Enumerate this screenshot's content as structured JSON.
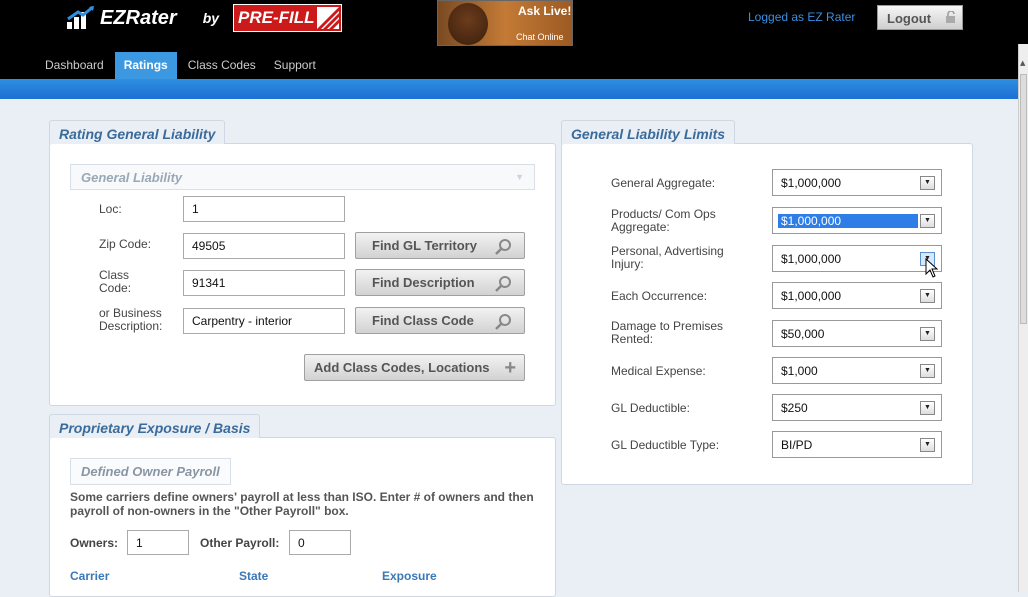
{
  "header": {
    "brand": "EZRater",
    "by": "by",
    "partner": "PRE-FILL",
    "ask_live_title": "Ask Live!",
    "ask_live_sub": "Chat Online",
    "logged_as": "Logged as EZ Rater",
    "logout_label": "Logout"
  },
  "nav": {
    "items": [
      {
        "label": "Dashboard"
      },
      {
        "label": "Ratings"
      },
      {
        "label": "Class Codes"
      },
      {
        "label": "Support"
      }
    ],
    "active": "Ratings"
  },
  "rating_panel": {
    "tab": "Rating General Liability",
    "accordion": "General Liability",
    "loc_label": "Loc:",
    "loc_value": "1",
    "zip_label": "Zip Code:",
    "zip_value": "49505",
    "class_label_1": "Class",
    "class_label_2": "Code:",
    "class_value": "91341",
    "biz_label_1": "or Business",
    "biz_label_2": "Description:",
    "biz_value": "Carpentry - interior",
    "btn_find_territory": "Find GL Territory",
    "btn_find_description": "Find Description",
    "btn_find_class_code": "Find Class Code",
    "btn_add_class_codes": "Add Class Codes, Locations"
  },
  "exposure_panel": {
    "tab": "Proprietary Exposure / Basis",
    "section_title": "Defined Owner Payroll",
    "note": "Some carriers define owners' payroll at less than ISO. Enter # of owners and then payroll of non-owners in the \"Other Payroll\" box.",
    "owners_label": "Owners:",
    "owners_value": "1",
    "other_payroll_label": "Other Payroll:",
    "other_payroll_value": "0",
    "columns": [
      "Carrier",
      "State",
      "Exposure"
    ]
  },
  "limits_panel": {
    "tab": "General Liability Limits",
    "rows": [
      {
        "label1": "General Aggregate:",
        "label2": "",
        "value": "$1,000,000"
      },
      {
        "label1": "Products/ Com Ops",
        "label2": "Aggregate:",
        "value": "$1,000,000"
      },
      {
        "label1": "Personal, Advertising",
        "label2": "Injury:",
        "value": "$1,000,000"
      },
      {
        "label1": "Each Occurrence:",
        "label2": "",
        "value": "$1,000,000"
      },
      {
        "label1": "Damage to Premises",
        "label2": "Rented:",
        "value": "$50,000"
      },
      {
        "label1": "Medical Expense:",
        "label2": "",
        "value": "$1,000"
      },
      {
        "label1": "GL Deductible:",
        "label2": "",
        "value": "$250"
      },
      {
        "label1": "GL Deductible Type:",
        "label2": "",
        "value": "BI/PD"
      }
    ]
  },
  "colors": {
    "nav_active": "#3c98e0",
    "accent_blue": "#1d6fd4",
    "tab_text": "#3a6b9a",
    "logged_text": "#3a8fe0"
  }
}
